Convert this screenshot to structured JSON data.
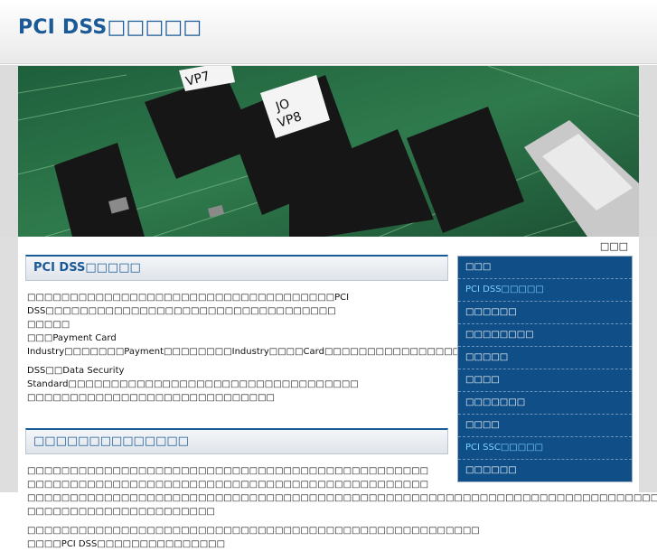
{
  "header": {
    "site_title": "PCI DSS□□□□□"
  },
  "hero": {
    "alt": "circuit board",
    "chip_labels": [
      "VP7",
      "JO VP8"
    ]
  },
  "top_link": "□□□",
  "main": {
    "section1_title": "PCI DSS□□□□□",
    "section1_p1": "□□□□□□□□□□□□□□□□□□□□□□□□□□□□□□□□□□□□PCI DSS□□□□□□□□□□□□□□□□□□□□□□□□□□□□□□□□□□",
    "section1_p1b": "□□□□□",
    "section1_p2": "□□□Payment Card Industry□□□□□□□Payment□□□□□□□□Industry□□□□Card□□□□□□□□□□□□□□□□",
    "section1_p3": "DSS□□Data Security Standard□□□□□□□□□□□□□□□□□□□□□□□□□□□□□□□□□□",
    "section1_p4": "□□□□□□□□□□□□□□□□□□□□□□□□□□□□□",
    "section2_title": "□□□□□□□□□□□□□□",
    "section2_p1": "□□□□□□□□□□□□□□□□□□□□□□□□□□□□□□□□□□□□□□□□□□□□□□□",
    "section2_p2": "□□□□□□□□□□□□□□□□□□□□□□□□□□□□□□□□□□□□□□□□□□□□□□□",
    "section2_p3": "□□□□□□□□□□□□□□□□□□□□□□□□□□□□□□□□□□□□□□□□□□□□□□□□□□□□□□□□□□□□□□□□□□□□□□□□□□□□",
    "section2_p3b": "□□□□□□□□□□□□□□□□□□□□□□",
    "section2_p4": "□□□□□□□□□□□□□□□□□□□□□□□□□□□□□□□□□□□□□□□□□□□□□□□□□□□□□",
    "section2_p4b": "□□□□PCI DSS□□□□□□□□□□□□□□□"
  },
  "sidebar": {
    "items": [
      {
        "label": "□□□"
      },
      {
        "label": "PCI DSS□□□□□"
      },
      {
        "label": "□□□□□□"
      },
      {
        "label": "□□□□□□□□"
      },
      {
        "label": "□□□□□"
      },
      {
        "label": "□□□□"
      },
      {
        "label": "□□□□□□□"
      },
      {
        "label": "□□□□"
      },
      {
        "label": "PCI SSC□□□□□"
      },
      {
        "label": "□□□□□□"
      }
    ]
  },
  "colors": {
    "brand_blue": "#1a5a96",
    "sidebar_bg": "#0f4e86",
    "sidebar_alt_text": "#7fd3ff"
  }
}
